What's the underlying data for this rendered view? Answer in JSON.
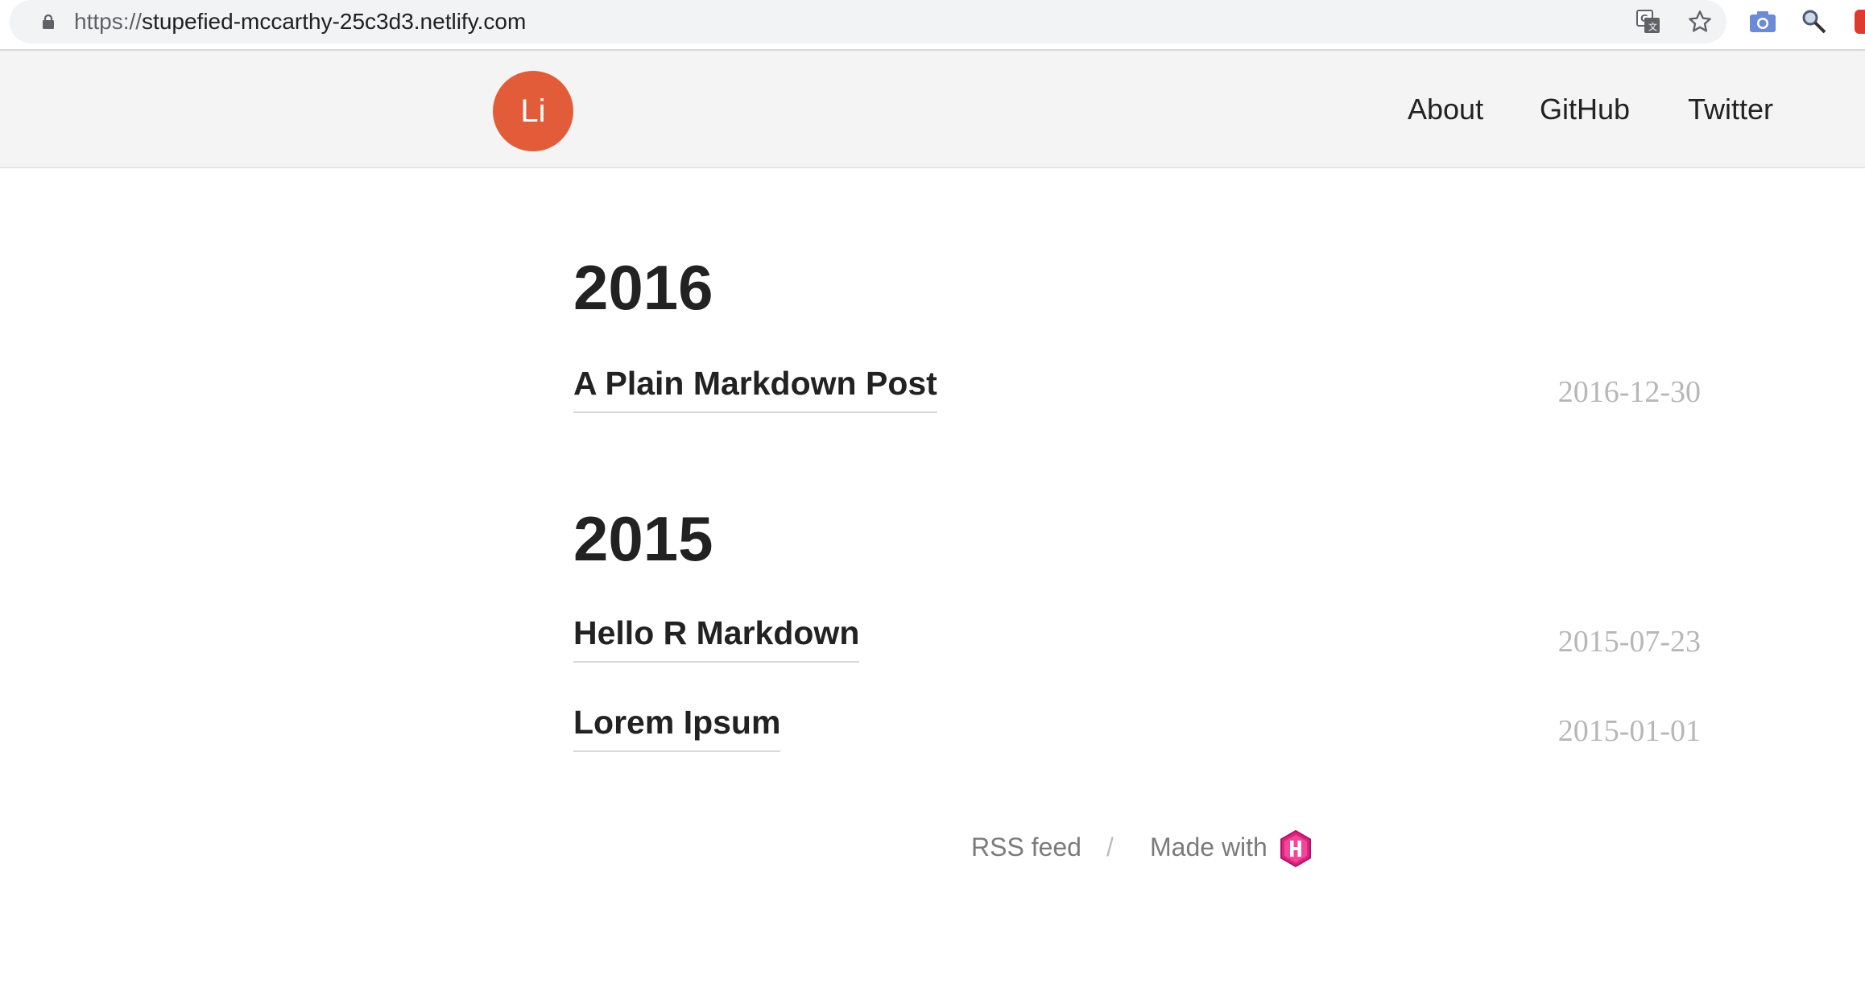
{
  "browser": {
    "url_scheme": "https://",
    "url_host": "stupefied-mccarthy-25c3d3.netlify.com",
    "icons": [
      "lock-icon",
      "translate-icon",
      "bookmark-star-icon",
      "camera-extension-icon",
      "search-extension-icon",
      "extension-icon"
    ]
  },
  "header": {
    "logo_text": "Li",
    "logo_color": "#e35c39",
    "nav": [
      {
        "label": "About"
      },
      {
        "label": "GitHub"
      },
      {
        "label": "Twitter"
      }
    ]
  },
  "archive": [
    {
      "year": "2016",
      "posts": [
        {
          "title": "A Plain Markdown Post",
          "date": "2016-12-30"
        }
      ]
    },
    {
      "year": "2015",
      "posts": [
        {
          "title": "Hello R Markdown",
          "date": "2015-07-23"
        },
        {
          "title": "Lorem Ipsum",
          "date": "2015-01-01"
        }
      ]
    }
  ],
  "footer": {
    "rss_label": "RSS feed",
    "separator": "/",
    "made_with_label": "Made with",
    "made_with_icon": "hugo-logo-icon",
    "hugo_color": "#e0227e"
  }
}
